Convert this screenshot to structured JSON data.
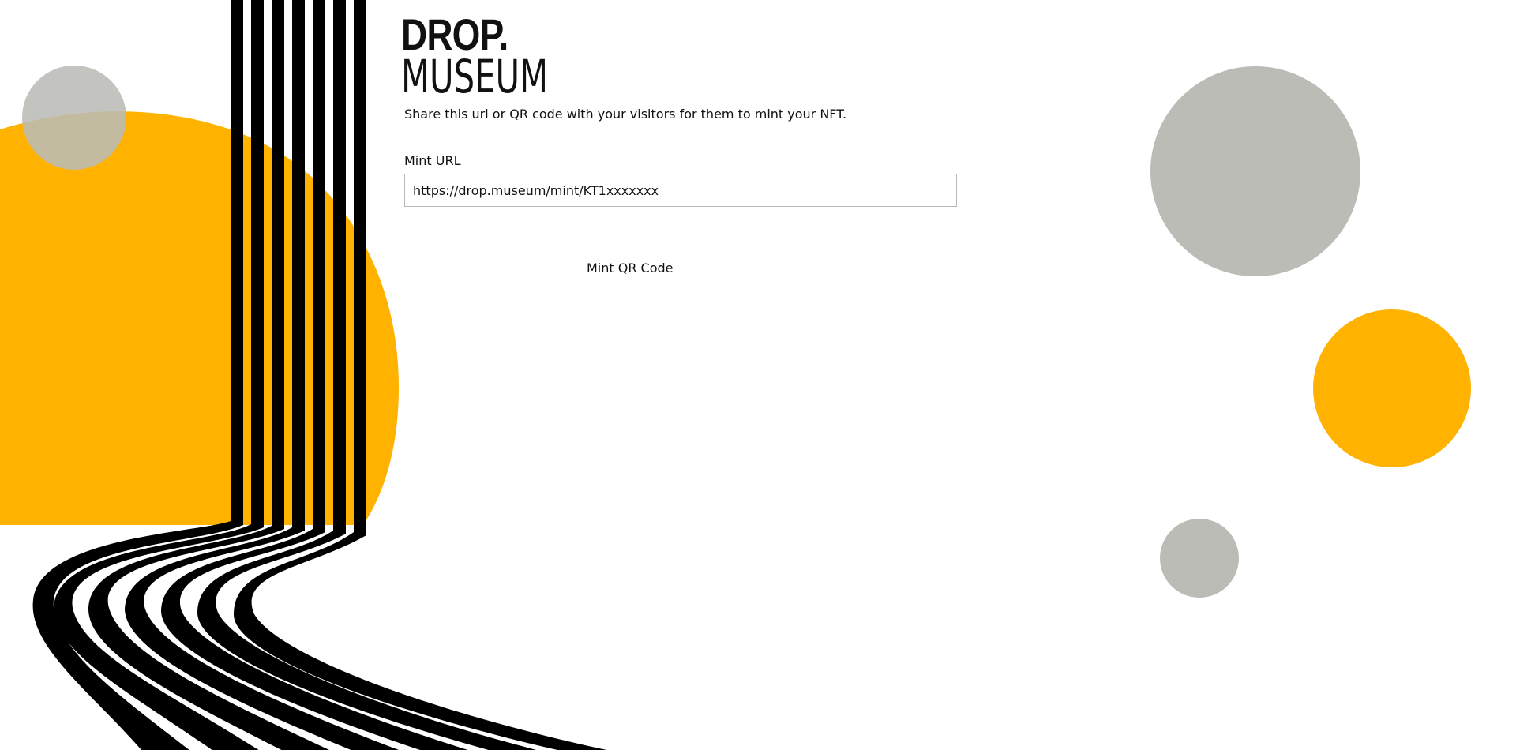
{
  "logo": {
    "line1": "DROP.",
    "line2": "MUSEUM"
  },
  "intro_text": "Share this url or QR code with your visitors for them to mint your NFT.",
  "mint_url": {
    "label": "Mint URL",
    "value": "https://drop.museum/mint/KT1xxxxxxx"
  },
  "qr": {
    "title": "Mint QR Code"
  },
  "colors": {
    "accent_yellow": "#FFB200",
    "circle_grey": "#BBBCB6",
    "stripe_black": "#000000"
  }
}
